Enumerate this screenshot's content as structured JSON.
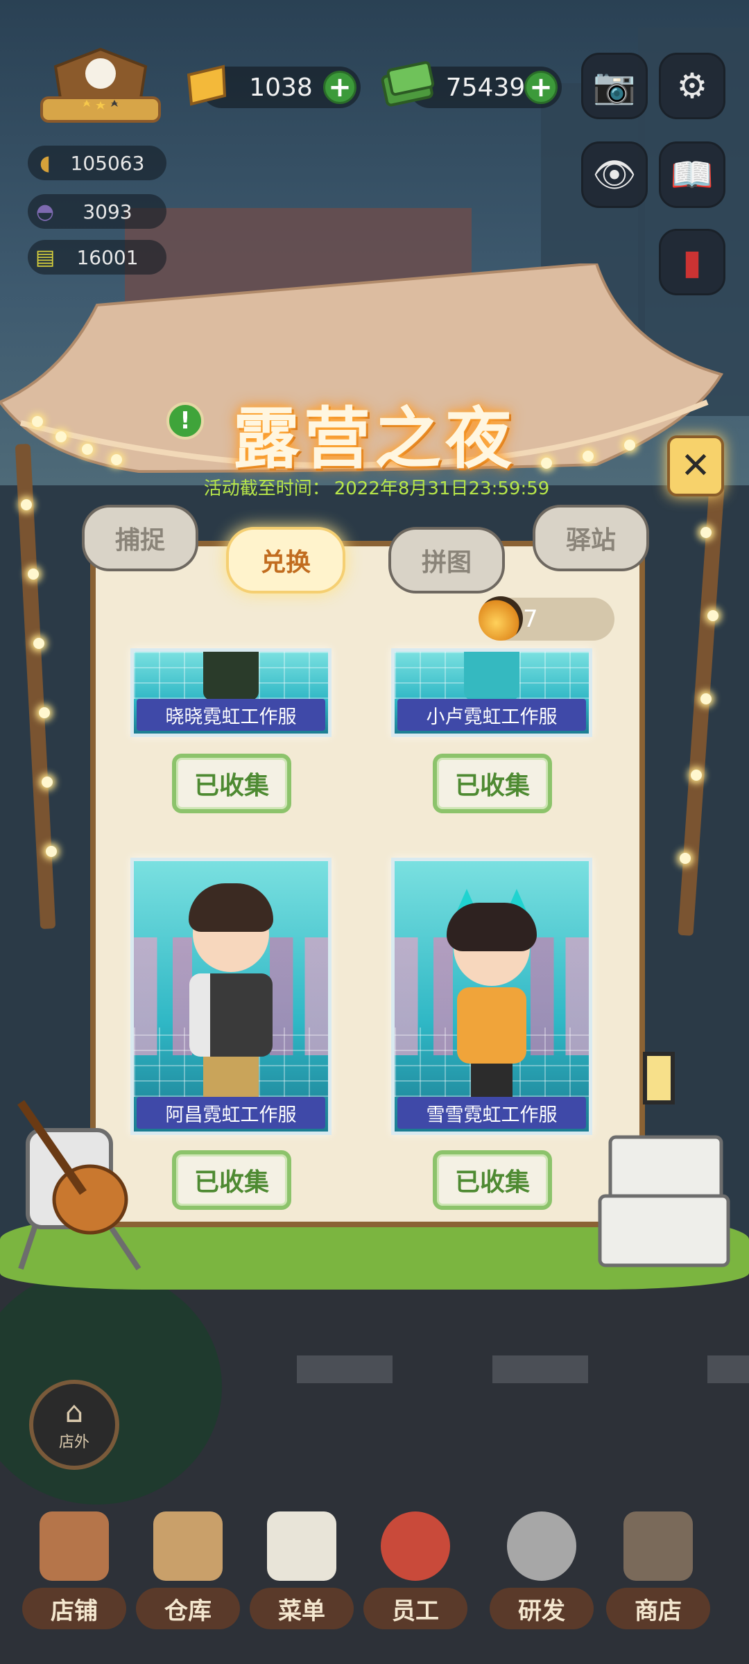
{
  "hud": {
    "gems": "1038",
    "cash": "75439",
    "stats": [
      {
        "icon": "pot-icon",
        "value": "105063"
      },
      {
        "icon": "helmet-icon",
        "value": "3093"
      },
      {
        "icon": "ticket-icon",
        "value": "16001"
      }
    ]
  },
  "event": {
    "title": "露营之夜",
    "deadline_label": "活动截至时间：",
    "deadline_value": "2022年8月31日23:59:59"
  },
  "tabs": [
    {
      "label": "捕捉",
      "active": false
    },
    {
      "label": "兑换",
      "active": true
    },
    {
      "label": "拼图",
      "active": false
    },
    {
      "label": "驿站",
      "active": false
    }
  ],
  "firefly_count": "7",
  "outfits": [
    {
      "name": "晓晓霓虹工作服",
      "button": "已收集"
    },
    {
      "name": "小卢霓虹工作服",
      "button": "已收集"
    },
    {
      "name": "阿昌霓虹工作服",
      "button": "已收集"
    },
    {
      "name": "雪雪霓虹工作服",
      "button": "已收集"
    }
  ],
  "outside_label": "店外",
  "nav": [
    {
      "label": "店铺",
      "icon": "shop-front-icon"
    },
    {
      "label": "仓库",
      "icon": "warehouse-box-icon"
    },
    {
      "label": "菜单",
      "icon": "clipboard-menu-icon"
    },
    {
      "label": "员工",
      "icon": "staff-person-icon"
    },
    {
      "label": "研发",
      "icon": "cooking-pot-icon"
    },
    {
      "label": "商店",
      "icon": "store-stall-icon"
    }
  ],
  "colors": {
    "accent_green": "#3c9a3a",
    "title_glow": "#ff8c1a",
    "deadline_text": "#b7e64a",
    "card_label_bg": "#3f49a8",
    "collect_border": "#8cc36b"
  }
}
